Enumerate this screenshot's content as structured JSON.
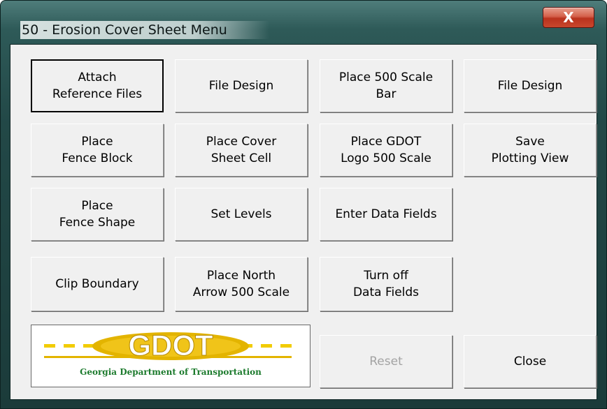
{
  "window": {
    "title": "50 - Erosion Cover Sheet Menu",
    "close_glyph": "X"
  },
  "buttons": [
    {
      "id": "attach-reference-files",
      "label": "Attach\nReference Files"
    },
    {
      "id": "file-design-1",
      "label": "File Design"
    },
    {
      "id": "place-500-scale-bar",
      "label": "Place 500 Scale\nBar"
    },
    {
      "id": "file-design-2",
      "label": "File Design"
    },
    {
      "id": "place-fence-block",
      "label": "Place\nFence Block"
    },
    {
      "id": "place-cover-sheet-cell",
      "label": "Place Cover\nSheet Cell"
    },
    {
      "id": "place-gdot-logo",
      "label": "Place GDOT\nLogo 500 Scale"
    },
    {
      "id": "save-plotting-view",
      "label": "Save\nPlotting View"
    },
    {
      "id": "place-fence-shape",
      "label": "Place\nFence Shape"
    },
    {
      "id": "set-levels",
      "label": "Set Levels"
    },
    {
      "id": "enter-data-fields",
      "label": "Enter Data Fields"
    },
    {
      "id": "clip-boundary",
      "label": "Clip Boundary"
    },
    {
      "id": "place-north-arrow",
      "label": "Place North\nArrow 500 Scale"
    },
    {
      "id": "turn-off-data-fields",
      "label": "Turn off\nData Fields"
    },
    {
      "id": "reset",
      "label": "Reset",
      "disabled": true
    },
    {
      "id": "close",
      "label": "Close"
    }
  ],
  "logo": {
    "wordmark": "GDOT",
    "caption": "Georgia Department of Transportation",
    "colors": {
      "gold": "#e3b400",
      "green": "#1b7a2c",
      "dash": "#f2cc00"
    },
    "icon": "gdot-logo"
  },
  "colors": {
    "frame": "#224847",
    "client_bg": "#f0f0f0",
    "close_button": "#c9472d",
    "disabled_text": "#a3a3a3"
  }
}
